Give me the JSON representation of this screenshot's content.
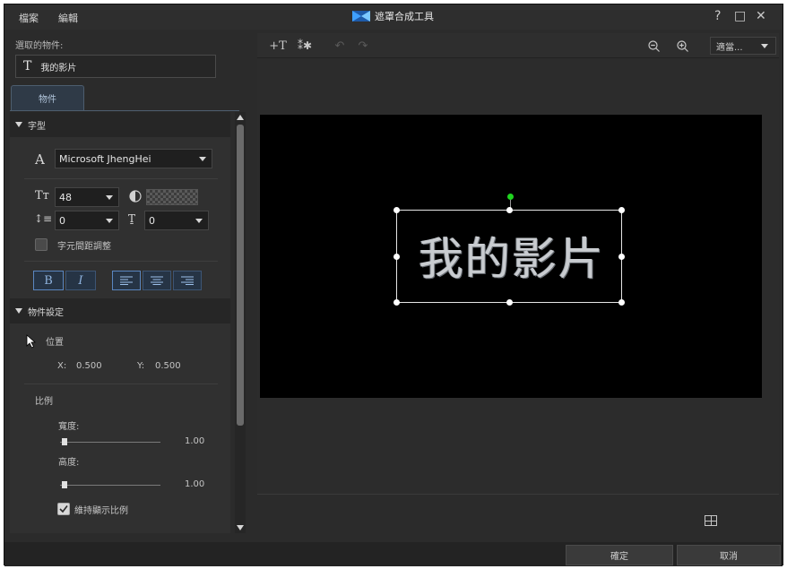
{
  "menu": {
    "file": "檔案",
    "edit": "編輯"
  },
  "window": {
    "title": "遮罩合成工具",
    "help": "?",
    "maximize": "□",
    "close": "✕"
  },
  "left": {
    "selected_label": "選取的物件:",
    "selected_name": "我的影片",
    "tab": "物件",
    "font_section": "字型",
    "font_name": "Microsoft JhengHei",
    "font_size": "48",
    "line_spacing": "0",
    "char_spacing": "0",
    "kerning_label": "字元間距調整",
    "object_section": "物件設定",
    "position_label": "位置",
    "x_label": "X:",
    "x_value": "0.500",
    "y_label": "Y:",
    "y_value": "0.500",
    "scale_label": "比例",
    "width_label": "寬度:",
    "width_value": "1.00",
    "height_label": "高度:",
    "height_value": "1.00",
    "keep_ratio_label": "維持顯示比例"
  },
  "toolbar": {
    "zoom_label": "適當..."
  },
  "preview": {
    "text": "我的影片"
  },
  "footer": {
    "ok": "確定",
    "cancel": "取消"
  },
  "colors": {
    "accent": "#5a86c0",
    "rotation_handle": "#1fd41f",
    "panel": "#2b2b2b"
  }
}
